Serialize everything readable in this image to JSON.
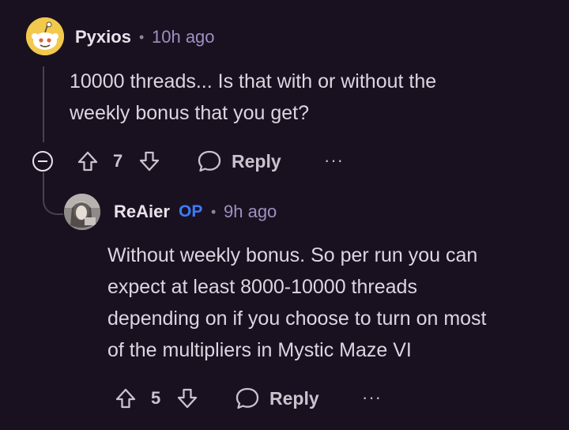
{
  "comments": [
    {
      "author": "Pyxios",
      "separator": "•",
      "time": "10h ago",
      "body_lines": [
        "10000 threads... Is that with or without the",
        "weekly bonus that you get?"
      ],
      "votes": "7",
      "reply_label": "Reply",
      "more_label": "···",
      "avatar_icon": "snoo-avatar-icon"
    },
    {
      "author": "ReAier",
      "op_badge": "OP",
      "separator": "•",
      "time": "9h ago",
      "body_lines": [
        "Without weekly bonus. So per run you can",
        "expect at least 8000-10000 threads",
        "depending on if you choose to turn on most",
        "of the multipliers in Mystic Maze VI"
      ],
      "votes": "5",
      "reply_label": "Reply",
      "more_label": "···",
      "avatar_icon": "user-photo-avatar"
    }
  ],
  "colors": {
    "background": "#1a1120",
    "op_badge": "#3d7bff",
    "time": "#9f8fc2",
    "thread_line": "#4a3f51"
  }
}
